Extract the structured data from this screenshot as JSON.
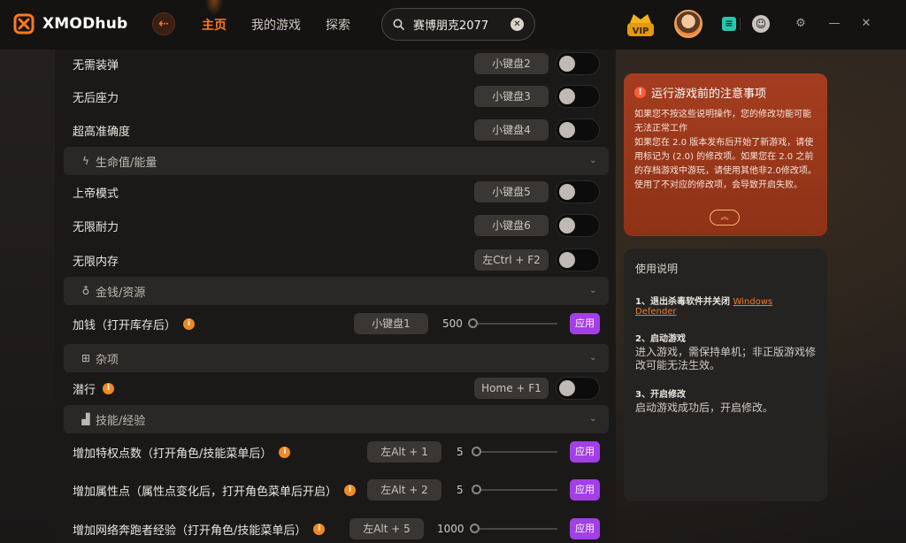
{
  "header": {
    "logo_text": "XMODhub",
    "nav": [
      "主页",
      "我的游戏",
      "探索"
    ],
    "search_value": "赛博朋克2077",
    "vip_label": "VIP"
  },
  "rows": {
    "r1": {
      "label": "无需装弹",
      "key": "小键盘2"
    },
    "r2": {
      "label": "无后座力",
      "key": "小键盘3"
    },
    "r3": {
      "label": "超高准确度",
      "key": "小键盘4"
    },
    "s1": {
      "title": "生命值/能量"
    },
    "r4": {
      "label": "上帝模式",
      "key": "小键盘5"
    },
    "r5": {
      "label": "无限耐力",
      "key": "小键盘6"
    },
    "r6": {
      "label": "无限内存",
      "key": "左Ctrl + F2"
    },
    "s2": {
      "title": "金钱/资源"
    },
    "r7": {
      "label": "加钱（打开库存后）",
      "key": "小键盘1",
      "value": "500",
      "apply": "应用"
    },
    "s3": {
      "title": "杂项"
    },
    "r8": {
      "label": "潜行",
      "key": "Home + F1"
    },
    "s4": {
      "title": "技能/经验"
    },
    "r9": {
      "label": "增加特权点数（打开角色/技能菜单后）",
      "key": "左Alt + 1",
      "value": "5",
      "apply": "应用"
    },
    "r10": {
      "label": "增加属性点（属性点变化后，打开角色菜单后开启）",
      "key": "左Alt + 2",
      "value": "5",
      "apply": "应用"
    },
    "r11": {
      "label": "增加网络奔跑者经验（打开角色/技能菜单后）",
      "key": "左Alt + 5",
      "value": "1000",
      "apply": "应用"
    }
  },
  "notice": {
    "title": "运行游戏前的注意事项",
    "body1": "如果您不按这些说明操作，您的修改功能可能无法正常工作",
    "body2": "如果您在 2.0 版本发布后开始了新游戏，请使用标记为 (2.0) 的修改项。如果您在 2.0 之前的存档游戏中游玩，请使用其他非2.0修改项。使用了不对应的修改项，会导致开启失败。"
  },
  "guide": {
    "title": "使用说明",
    "step1_title": "1、退出杀毒软件并关闭",
    "step1_link": "Windows Defender",
    "step2_title": "2、启动游戏",
    "step2_body": "进入游戏，需保持单机；非正版游戏修改可能无法生效。",
    "step3_title": "3、开启修改",
    "step3_body": "启动游戏成功后，开启修改。"
  },
  "colors": {
    "accent": "#ff7a1a",
    "apply": "#a23fe6",
    "notice_bg": "#a53d20"
  }
}
